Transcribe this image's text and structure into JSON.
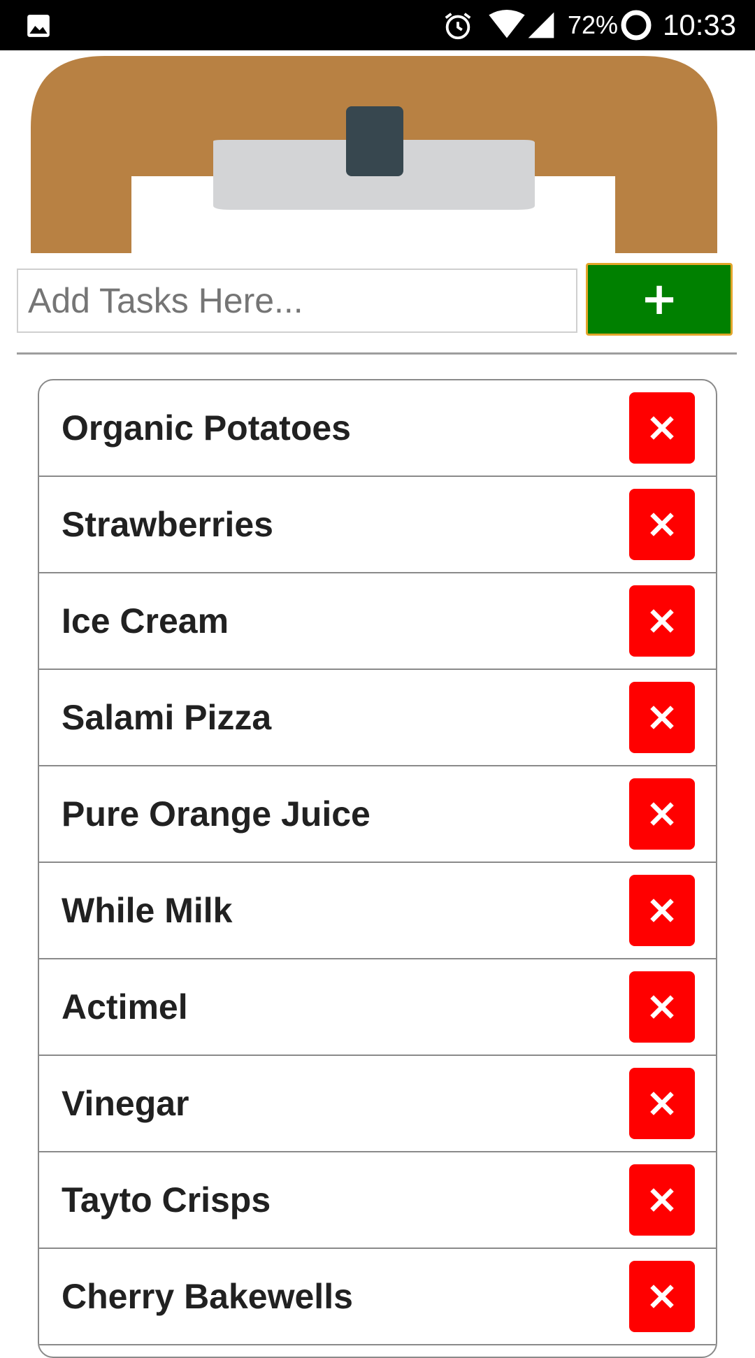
{
  "status_bar": {
    "battery_percent": "72%",
    "time": "10:33",
    "icons": [
      "gallery-icon",
      "alarm-icon",
      "wifi-icon",
      "signal-icon",
      "battery-icon"
    ]
  },
  "header": {
    "image": "clipboard-header-image",
    "colors": {
      "board": "#b88143",
      "clip": "#d3d4d6",
      "clip_tab": "#37474f"
    }
  },
  "add_task": {
    "placeholder": "Add Tasks Here...",
    "value": "",
    "button_label": "+",
    "button_color": "#008000"
  },
  "tasks": [
    {
      "label": "Organic Potatoes"
    },
    {
      "label": "Strawberries"
    },
    {
      "label": "Ice Cream"
    },
    {
      "label": "Salami Pizza"
    },
    {
      "label": "Pure Orange Juice"
    },
    {
      "label": "While Milk"
    },
    {
      "label": "Actimel"
    },
    {
      "label": "Vinegar"
    },
    {
      "label": "Tayto Crisps"
    },
    {
      "label": "Cherry Bakewells"
    }
  ],
  "delete_button": {
    "icon": "close-icon",
    "color": "#ff0000"
  }
}
